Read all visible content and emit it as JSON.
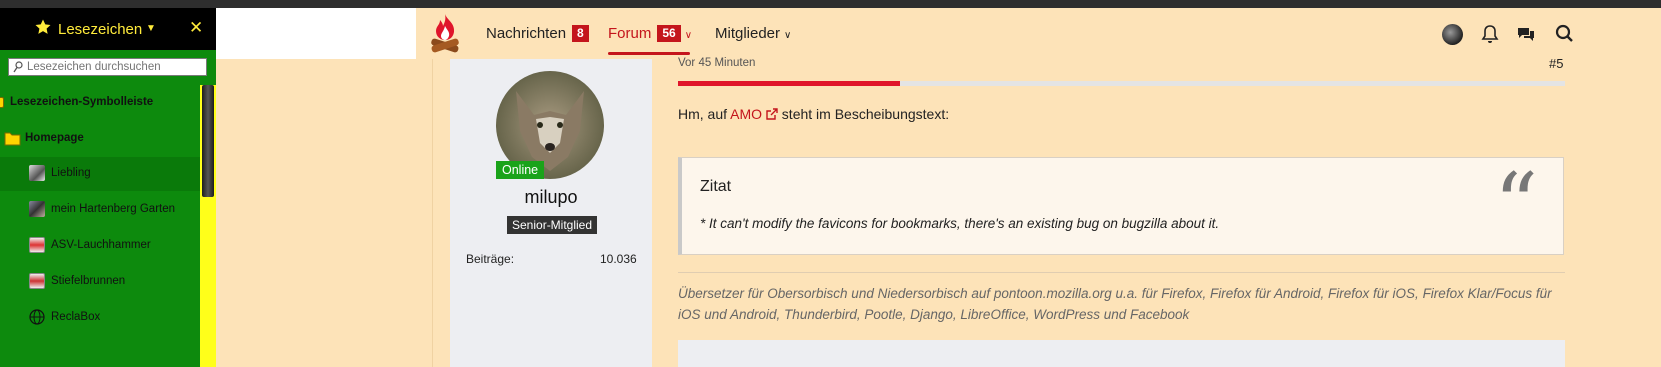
{
  "sidebar": {
    "title": "Lesezeichen",
    "close_glyph": "✕",
    "search_placeholder": "Lesezeichen durchsuchen",
    "items": [
      {
        "label": "Lesezeichen-Symbolleiste",
        "icon": "folder-icon"
      },
      {
        "label": "Homepage",
        "icon": "folder-icon"
      },
      {
        "label": "Liebling",
        "icon": "favicon-image"
      },
      {
        "label": "mein Hartenberg Garten",
        "icon": "favicon-image"
      },
      {
        "label": "ASV-Lauchhammer",
        "icon": "favicon-image"
      },
      {
        "label": "Stiefelbrunnen",
        "icon": "favicon-image"
      },
      {
        "label": "ReclaBox",
        "icon": "globe-icon"
      }
    ]
  },
  "header": {
    "nav": [
      {
        "label": "Nachrichten",
        "badge": "8"
      },
      {
        "label": "Forum",
        "badge": "56"
      },
      {
        "label": "Mitglieder"
      }
    ]
  },
  "user": {
    "status": "Online",
    "name": "milupo",
    "rank": "Senior-Mitglied",
    "stat_label": "Beiträge:",
    "stat_value": "10.036"
  },
  "post": {
    "time": "Vor 45 Minuten",
    "number": "#5",
    "read_progress": 0.25,
    "text_before": "Hm, auf ",
    "link": "AMO",
    "text_after": " steht im Bescheibungstext:",
    "quote_title": "Zitat",
    "quote_text": "* It can't modify the favicons for bookmarks, there's an existing bug on bugzilla about it.",
    "signature": "Übersetzer für Obersorbisch und Niedersorbisch auf pontoon.mozilla.org u.a. für Firefox, Firefox für Android, Firefox für iOS, Firefox Klar/Focus für iOS und Android, Thunderbird, Pootle, Django, LibreOffice, WordPress und Facebook"
  },
  "colors": {
    "accent": "#c4151c",
    "sidebar_bg": "#0d8a0d",
    "page_bg": "#fde3b8",
    "online": "#1aa31a"
  }
}
